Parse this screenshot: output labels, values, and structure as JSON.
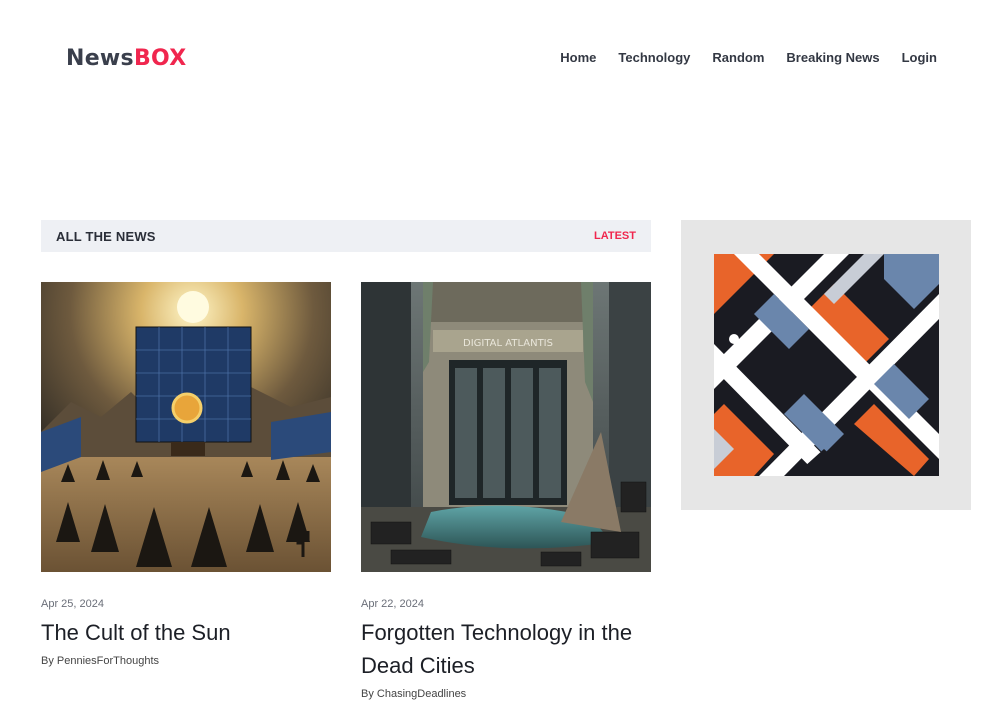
{
  "brand": {
    "part1": "News",
    "part2": "BOX"
  },
  "nav": [
    "Home",
    "Technology",
    "Random",
    "Breaking News",
    "Login"
  ],
  "section": {
    "title": "ALL THE NEWS",
    "tab": "LATEST"
  },
  "articles": [
    {
      "date": "Apr 25, 2024",
      "title": "The Cult of the Sun",
      "byline_prefix": "By",
      "author": "PenniesForThoughts"
    },
    {
      "date": "Apr 22, 2024",
      "title": "Forgotten Technology in the Dead Cities",
      "byline_prefix": "By",
      "author": "ChasingDeadlines",
      "image_sign": "DIGITAL ATLANTIS"
    }
  ],
  "colors": {
    "accent": "#f0264e",
    "bar": "#eef0f4",
    "text": "#1c1f26"
  }
}
